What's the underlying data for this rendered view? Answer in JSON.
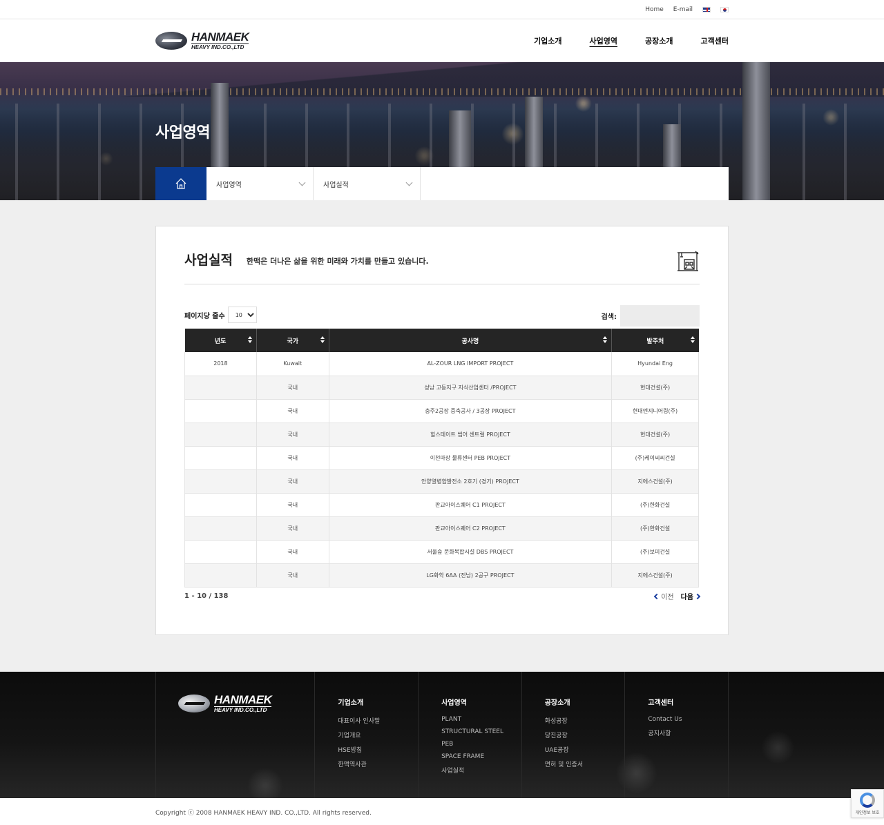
{
  "topbar": {
    "links": [
      "Home",
      "E-mail"
    ],
    "flags": [
      "uk-flag-icon",
      "kr-flag-icon"
    ]
  },
  "header": {
    "logo": {
      "line1": "HANMAEK",
      "line2": "HEAVY IND.CO.,LTD"
    },
    "nav": [
      "기업소개",
      "사업영역",
      "공장소개",
      "고객센터"
    ],
    "active_nav": "사업영역"
  },
  "hero": {
    "title": "사업영역"
  },
  "breadcrumb": {
    "level1": "사업영역",
    "level2": "사업실적"
  },
  "content": {
    "title": "사업실적",
    "subtitle": "한맥은 더나은 삶을 위한 미래와 가치를 만들고 있습니다.",
    "perpage_label": "페이지당 줄수",
    "perpage_value": "10",
    "search_label": "검색:",
    "columns": [
      "년도",
      "국가",
      "공사명",
      "발주처"
    ],
    "rows": [
      [
        "2018",
        "Kuwait",
        "AL-ZOUR LNG IMPORT PROJECT",
        "Hyundai Eng"
      ],
      [
        "",
        "국내",
        "성남 고등지구 지식산업센터 /PROJECT",
        "현대건설(주)"
      ],
      [
        "",
        "국내",
        "충주2공장 증축공사 / 3공장 PROJECT",
        "현대엔지니어링(주)"
      ],
      [
        "",
        "국내",
        "힐스테이트 범어 센트럴 PROJECT",
        "현대건설(주)"
      ],
      [
        "",
        "국내",
        "이천마장 물류센터 PEB PROJECT",
        "(주)케이씨씨건설"
      ],
      [
        "",
        "국내",
        "안양열병합발전소 2호기 (경기) PROJECT",
        "지에스건설(주)"
      ],
      [
        "",
        "국내",
        "판교아이스퀘어 C1 PROJECT",
        "(주)한화건설"
      ],
      [
        "",
        "국내",
        "판교아이스퀘어 C2 PROJECT",
        "(주)한화건설"
      ],
      [
        "",
        "국내",
        "서울숲 문화복합시설 DBS PROJECT",
        "(주)보미건설"
      ],
      [
        "",
        "국내",
        "LG화학 6AA (전남) 2공구 PROJECT",
        "지에스건설(주)"
      ]
    ],
    "pager_info": "1 - 10 / 138",
    "prev_label": "이전",
    "next_label": "다음"
  },
  "footer": {
    "logo": {
      "line1": "HANMAEK",
      "line2": "HEAVY IND.CO.,LTD"
    },
    "columns": [
      {
        "title": "기업소개",
        "items": [
          "대표이사 인사말",
          "기업개요",
          "HSE방침",
          "한맥역사관"
        ]
      },
      {
        "title": "사업영역",
        "items": [
          "PLANT",
          "STRUCTURAL STEEL",
          "PEB",
          "SPACE FRAME",
          "사업실적"
        ]
      },
      {
        "title": "공장소개",
        "items": [
          "화성공장",
          "당진공장",
          "UAE공장",
          "면허 및 인증서"
        ]
      },
      {
        "title": "고객센터",
        "items": [
          "Contact Us",
          "공지사항"
        ]
      }
    ],
    "copyright": "Copyright ⓒ 2008 HANMAEK HEAVY IND. CO.,LTD. All rights reserved.",
    "recaptcha_label": "개인정보 보호"
  }
}
